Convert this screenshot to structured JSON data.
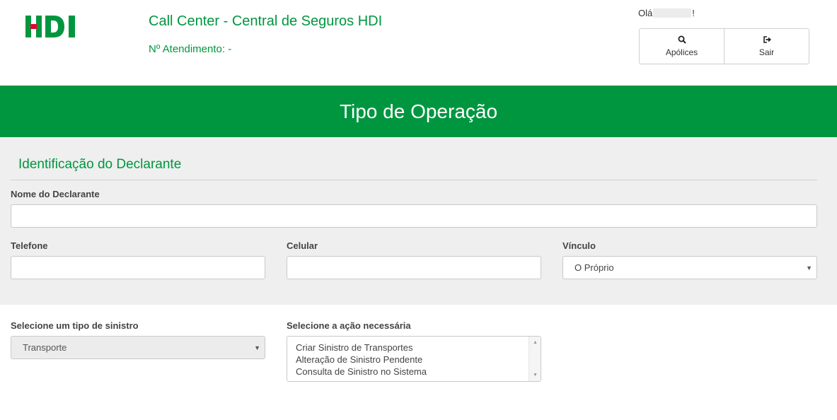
{
  "header": {
    "logo_text": "HDI",
    "title": "Call Center - Central de Seguros HDI",
    "subtitle": "Nº Atendimento: -",
    "greeting_prefix": "Olá",
    "greeting_suffix": "!",
    "buttons": [
      {
        "label": "Apólices",
        "icon": "search-icon"
      },
      {
        "label": "Sair",
        "icon": "sign-out-icon"
      }
    ]
  },
  "banner": {
    "title": "Tipo de Operação"
  },
  "declarante": {
    "section_title": "Identificação do Declarante",
    "nome_label": "Nome do Declarante",
    "nome_value": "",
    "telefone_label": "Telefone",
    "telefone_value": "",
    "celular_label": "Celular",
    "celular_value": "",
    "vinculo_label": "Vínculo",
    "vinculo_selected": "O Próprio"
  },
  "sinistro": {
    "tipo_label": "Selecione um tipo de sinistro",
    "tipo_selected": "Transporte",
    "acao_label": "Selecione a ação necessária",
    "acao_options": [
      "Criar Sinistro de Transportes",
      "Alteração de Sinistro Pendente",
      "Consulta de Sinistro no Sistema"
    ]
  },
  "colors": {
    "brand_green": "#00963f",
    "panel_gray": "#efefef",
    "logo_red": "#e4032e"
  }
}
